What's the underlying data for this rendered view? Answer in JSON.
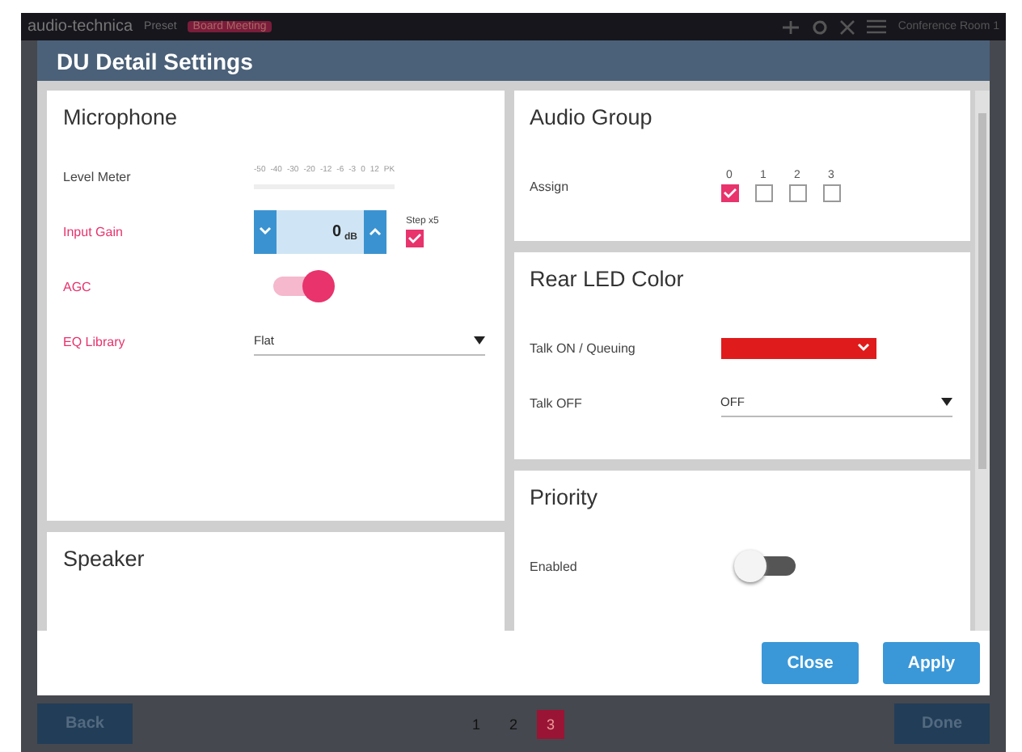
{
  "app_bar": {
    "logo": "audio-technica",
    "preset_label": "Preset",
    "preset_badge": "Board Meeting",
    "room": "Conference Room 1"
  },
  "dialog": {
    "title": "DU Detail Settings",
    "microphone": {
      "title": "Microphone",
      "level_meter": {
        "label": "Level Meter",
        "scale": [
          "-50",
          "-40",
          "-30",
          "-20",
          "-12",
          "-6",
          "-3",
          "0",
          "12",
          "PK"
        ]
      },
      "input_gain": {
        "label": "Input Gain",
        "value": "0",
        "unit": "dB",
        "step_label": "Step x5",
        "step_checked": true
      },
      "agc": {
        "label": "AGC",
        "on": true
      },
      "eq_library": {
        "label": "EQ Library",
        "value": "Flat"
      }
    },
    "speaker": {
      "title": "Speaker"
    },
    "audio_group": {
      "title": "Audio Group",
      "label": "Assign",
      "groups": [
        {
          "label": "0",
          "checked": true
        },
        {
          "label": "1",
          "checked": false
        },
        {
          "label": "2",
          "checked": false
        },
        {
          "label": "3",
          "checked": false
        }
      ]
    },
    "rear_led": {
      "title": "Rear LED Color",
      "talk_on": {
        "label": "Talk ON / Queuing",
        "color": "#e01b1b"
      },
      "talk_off": {
        "label": "Talk OFF",
        "value": "OFF"
      }
    },
    "priority": {
      "title": "Priority",
      "label": "Enabled",
      "on": false
    },
    "buttons": [
      "Close",
      "Apply"
    ]
  },
  "footer": {
    "back": "Back",
    "done": "Done",
    "pages": [
      {
        "label": "1",
        "selected": false
      },
      {
        "label": "2",
        "selected": false
      },
      {
        "label": "3",
        "selected": true
      }
    ]
  }
}
